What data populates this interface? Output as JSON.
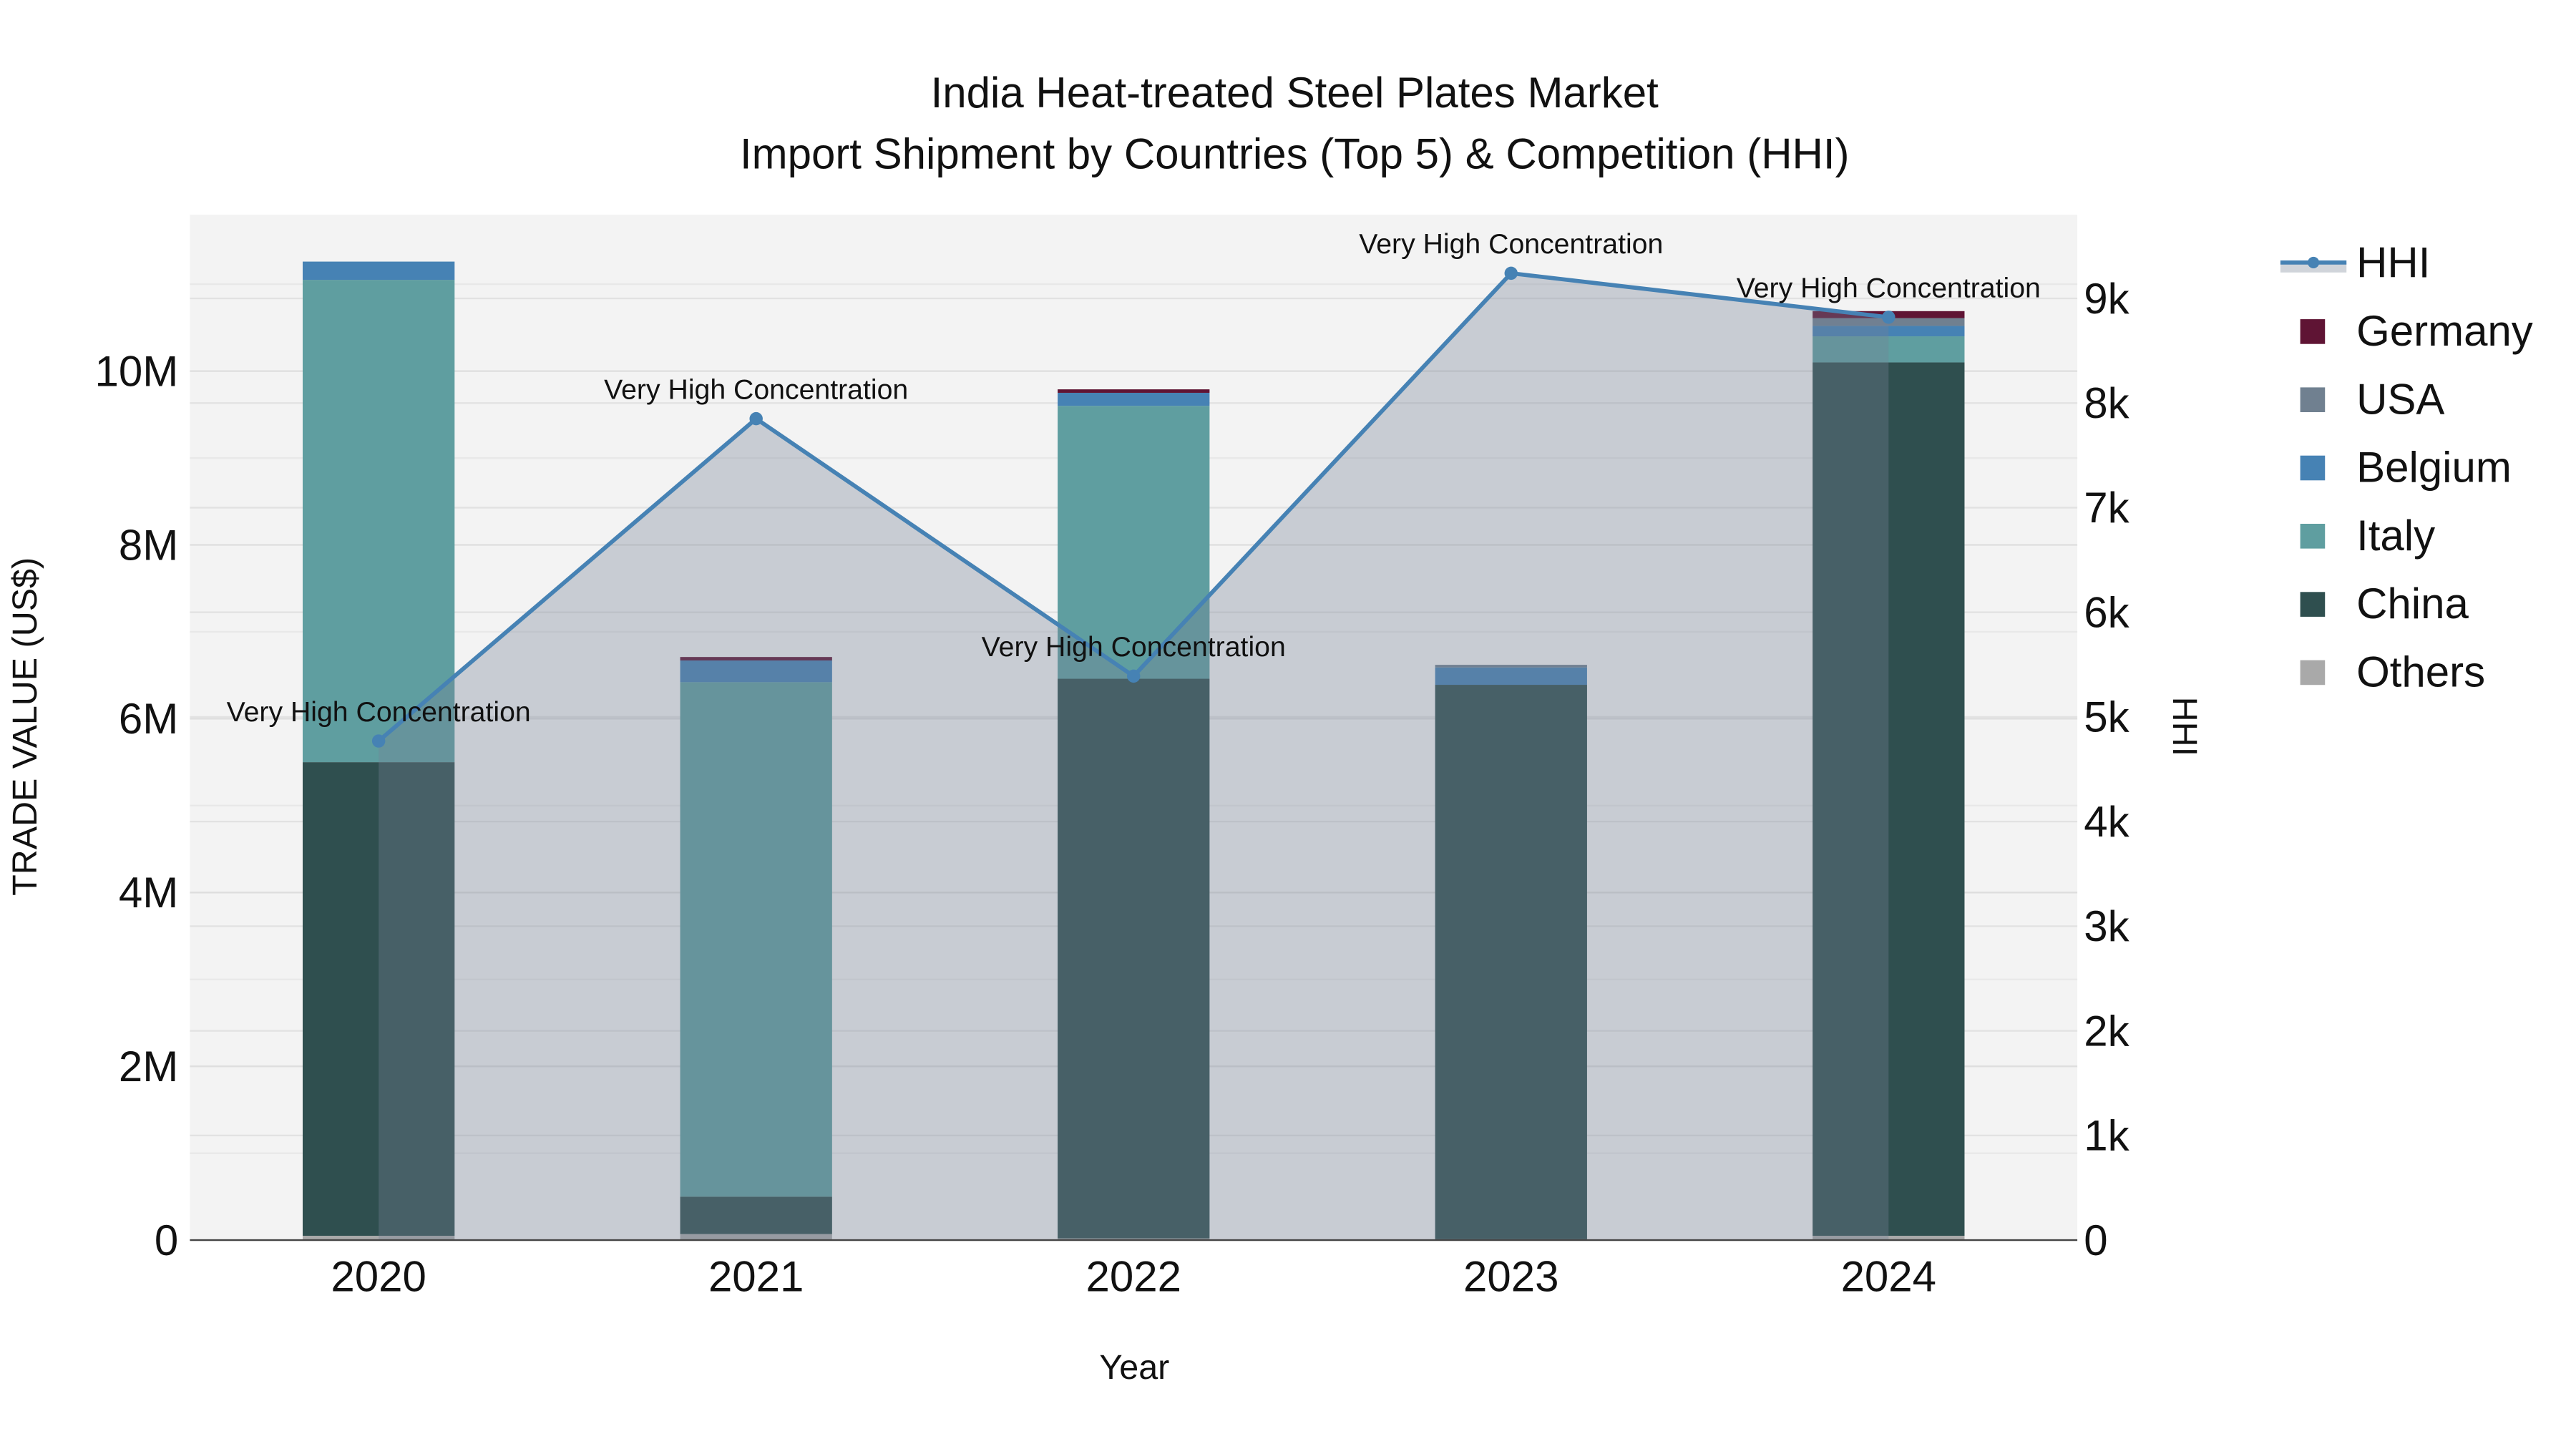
{
  "chart_data": {
    "type": "bar",
    "title": "India Heat-treated Steel Plates Market",
    "subtitle": "Import Shipment by Countries (Top 5) & Competition (HHI)",
    "xlabel": "Year",
    "ylabel": "TRADE VALUE (US$)",
    "y2label": "HHI",
    "categories": [
      "2020",
      "2021",
      "2022",
      "2023",
      "2024"
    ],
    "ylim": [
      0,
      11800000
    ],
    "y2lim": [
      0,
      9800
    ],
    "yticks": [
      {
        "v": 0,
        "label": "0"
      },
      {
        "v": 2000000,
        "label": "2M"
      },
      {
        "v": 4000000,
        "label": "4M"
      },
      {
        "v": 6000000,
        "label": "6M"
      },
      {
        "v": 8000000,
        "label": "8M"
      },
      {
        "v": 10000000,
        "label": "10M"
      }
    ],
    "y2ticks": [
      {
        "v": 0,
        "label": "0"
      },
      {
        "v": 1000,
        "label": "1k"
      },
      {
        "v": 2000,
        "label": "2k"
      },
      {
        "v": 3000,
        "label": "3k"
      },
      {
        "v": 4000,
        "label": "4k"
      },
      {
        "v": 5000,
        "label": "5k"
      },
      {
        "v": 6000,
        "label": "6k"
      },
      {
        "v": 7000,
        "label": "7k"
      },
      {
        "v": 8000,
        "label": "8k"
      },
      {
        "v": 9000,
        "label": "9k"
      }
    ],
    "series": [
      {
        "name": "Others",
        "color": "#a9a9a9",
        "values": [
          50000,
          70000,
          20000,
          10000,
          50000
        ]
      },
      {
        "name": "China",
        "color": "#2f4f4f",
        "values": [
          5450000,
          430000,
          6440000,
          6380000,
          10050000
        ]
      },
      {
        "name": "Italy",
        "color": "#5f9ea0",
        "values": [
          5550000,
          5920000,
          3140000,
          0,
          300000
        ]
      },
      {
        "name": "Belgium",
        "color": "#4682b4",
        "values": [
          210000,
          250000,
          150000,
          200000,
          120000
        ]
      },
      {
        "name": "USA",
        "color": "#708090",
        "values": [
          0,
          0,
          0,
          30000,
          90000
        ]
      },
      {
        "name": "Germany",
        "color": "#5f1434",
        "values": [
          0,
          40000,
          40000,
          0,
          80000
        ]
      }
    ],
    "hhi": {
      "name": "HHI",
      "color": "#4682b4",
      "values": [
        4770,
        7850,
        5390,
        9240,
        8820
      ]
    },
    "annotations": [
      "Very High Concentration",
      "Very High Concentration",
      "Very High Concentration",
      "Very High Concentration",
      "Very High Concentration"
    ],
    "legend_order": [
      "HHI",
      "Germany",
      "USA",
      "Belgium",
      "Italy",
      "China",
      "Others"
    ],
    "legend_position": "right",
    "grid": true
  }
}
